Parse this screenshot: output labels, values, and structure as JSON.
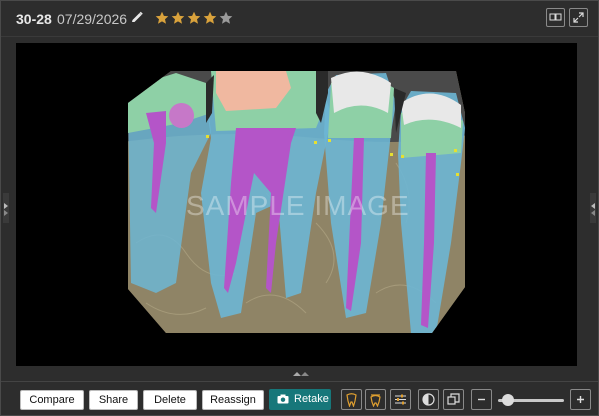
{
  "header": {
    "record_id": "30-28",
    "date": "07/29/2026",
    "rating": 4,
    "rating_max": 5,
    "icons": [
      "pencil-icon",
      "compare-layout-icon",
      "expand-icon"
    ]
  },
  "viewer": {
    "watermark": "SAMPLE IMAGE"
  },
  "toolbar": {
    "compare_label": "Compare",
    "share_label": "Share",
    "delete_label": "Delete",
    "reassign_label": "Reassign",
    "retake_label": "Retake",
    "zoom_level": 0.15
  },
  "colors": {
    "star_filled": "#d9a23c",
    "star_empty": "#9a9a9a",
    "retake_bg": "#17777a",
    "tool_accent": "#e0a030"
  }
}
